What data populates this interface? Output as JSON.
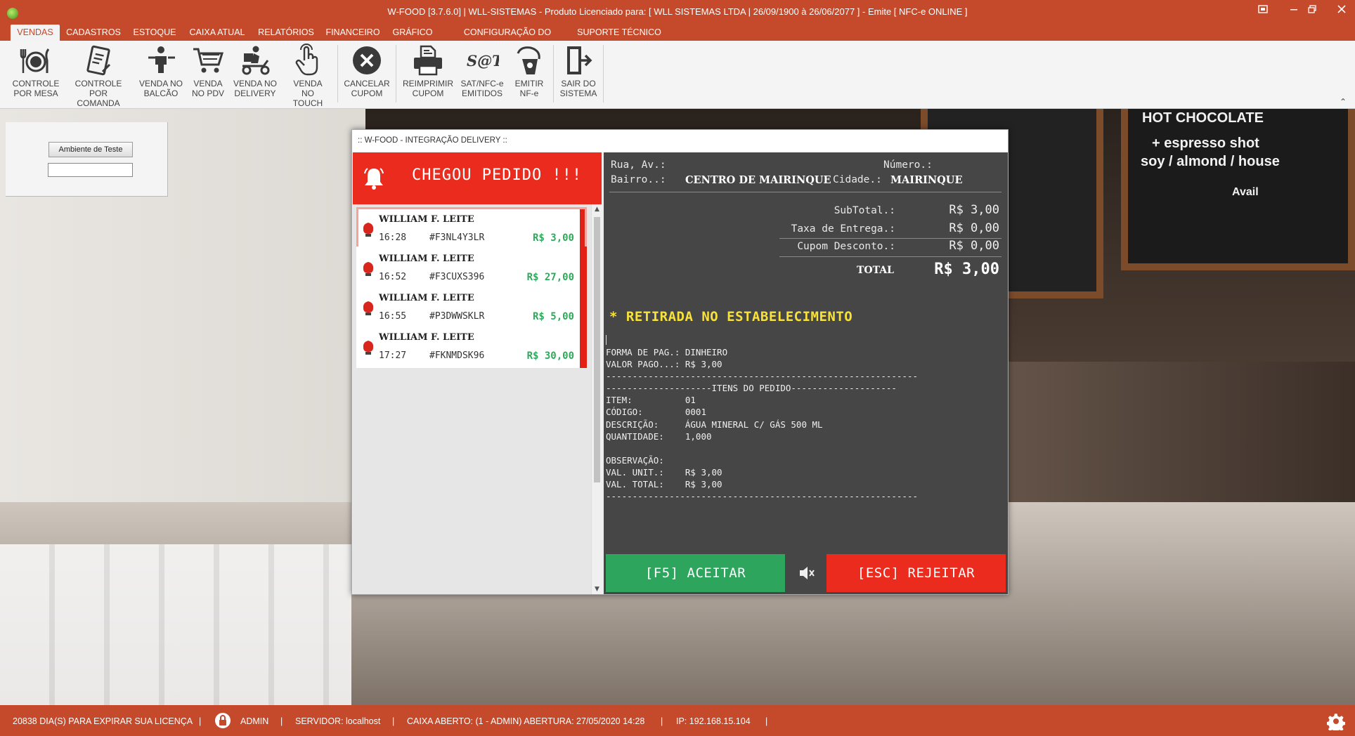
{
  "window": {
    "title": "W-FOOD [3.7.6.0] | WLL-SISTEMAS - Produto Licenciado para:  [ WLL SISTEMAS LTDA | 26/09/1900 à 26/06/2077 ] - Emite [ NFC-e ONLINE ]"
  },
  "menu": [
    {
      "label": "VENDAS"
    },
    {
      "label": "CADASTROS"
    },
    {
      "label": "ESTOQUE"
    },
    {
      "label": "CAIXA ATUAL"
    },
    {
      "label": "RELATÓRIOS"
    },
    {
      "label": "FINANCEIRO"
    },
    {
      "label": "GRÁFICO"
    },
    {
      "label": "CONFIGURAÇÃO DO SISTEMA"
    },
    {
      "label": "SUPORTE TÉCNICO"
    }
  ],
  "ribbon": [
    {
      "l1": "CONTROLE",
      "l2": "POR MESA"
    },
    {
      "l1": "CONTROLE POR",
      "l2": "COMANDA"
    },
    {
      "l1": "VENDA NO",
      "l2": "BALCÃO"
    },
    {
      "l1": "VENDA",
      "l2": "NO PDV"
    },
    {
      "l1": "VENDA NO",
      "l2": "DELIVERY"
    },
    {
      "l1": "VENDA NO",
      "l2": "TOUCH"
    },
    {
      "l1": "CANCELAR",
      "l2": "CUPOM"
    },
    {
      "l1": "REIMPRIMIR",
      "l2": "CUPOM"
    },
    {
      "l1": "SAT/NFC-e",
      "l2": "EMITIDOS"
    },
    {
      "l1": "EMITIR",
      "l2": "NF-e"
    },
    {
      "l1": "SAIR DO",
      "l2": "SISTEMA"
    }
  ],
  "background": {
    "board_line1": "HOT CHOCOLATE",
    "board_line2": "+ espresso shot",
    "board_line3": "soy / almond / house",
    "board_line4": "Avail"
  },
  "left_panel": {
    "env_button": "Ambiente de Teste",
    "env_input_value": ""
  },
  "dialog": {
    "title": ":: W-FOOD - INTEGRAÇÃO DELIVERY ::",
    "alert": "CHEGOU PEDIDO !!!",
    "orders": [
      {
        "name": "WILLIAM F. LEITE",
        "time": "16:28",
        "code": "#F3NL4Y3LR",
        "price": "R$ 3,00"
      },
      {
        "name": "WILLIAM F. LEITE",
        "time": "16:52",
        "code": "#F3CUXS396",
        "price": "R$ 27,00"
      },
      {
        "name": "WILLIAM F. LEITE",
        "time": "16:55",
        "code": "#P3DWWSKLR",
        "price": "R$ 5,00"
      },
      {
        "name": "WILLIAM F. LEITE",
        "time": "17:27",
        "code": "#FKNMDSK96",
        "price": "R$ 30,00"
      }
    ],
    "detail": {
      "street_label": "Rua, Av.:",
      "number_label": "Número.:",
      "district_label": "Bairro..:",
      "district_value": "CENTRO DE MAIRINQUE",
      "city_label": "Cidade.:",
      "city_value": "MAIRINQUE",
      "subtotal_label": "SubTotal.:",
      "subtotal_value": "R$ 3,00",
      "delivery_label": "Taxa de Entrega.:",
      "delivery_value": "R$ 0,00",
      "discount_label": "Cupom Desconto.:",
      "discount_value": "R$ 0,00",
      "total_label": "TOTAL",
      "total_value": "R$ 3,00",
      "pickup": "* RETIRADA NO ESTABELECIMENTO",
      "receipt": "FORMA DE PAG.: DINHEIRO\nVALOR PAGO...: R$ 3,00\n-----------------------------------------------------------\n--------------------ITENS DO PEDIDO--------------------\nITEM:          01\nCÓDIGO:        0001\nDESCRIÇÃO:     ÁGUA MINERAL C/ GÁS 500 ML\nQUANTIDADE:    1,000\n\nOBSERVAÇÃO:\nVAL. UNIT.:    R$ 3,00\nVAL. TOTAL:    R$ 3,00\n-----------------------------------------------------------",
      "accept_label": "[F5] ACEITAR",
      "reject_label": "[ESC] REJEITAR"
    }
  },
  "status": {
    "license": "20838 DIA(S) PARA EXPIRAR SUA LICENÇA",
    "user": "ADMIN",
    "server": "SERVIDOR: localhost",
    "cashier": "CAIXA ABERTO: (1 - ADMIN) ABERTURA: 27/05/2020 14:28",
    "ip": "IP: 192.168.15.104",
    "sep": "|"
  },
  "colors": {
    "brand": "#c5492b",
    "alert_red": "#ea2b1d",
    "accept_green": "#2ea55d",
    "price_green": "#2eaa5b",
    "pickup_yellow": "#f7e13a"
  }
}
